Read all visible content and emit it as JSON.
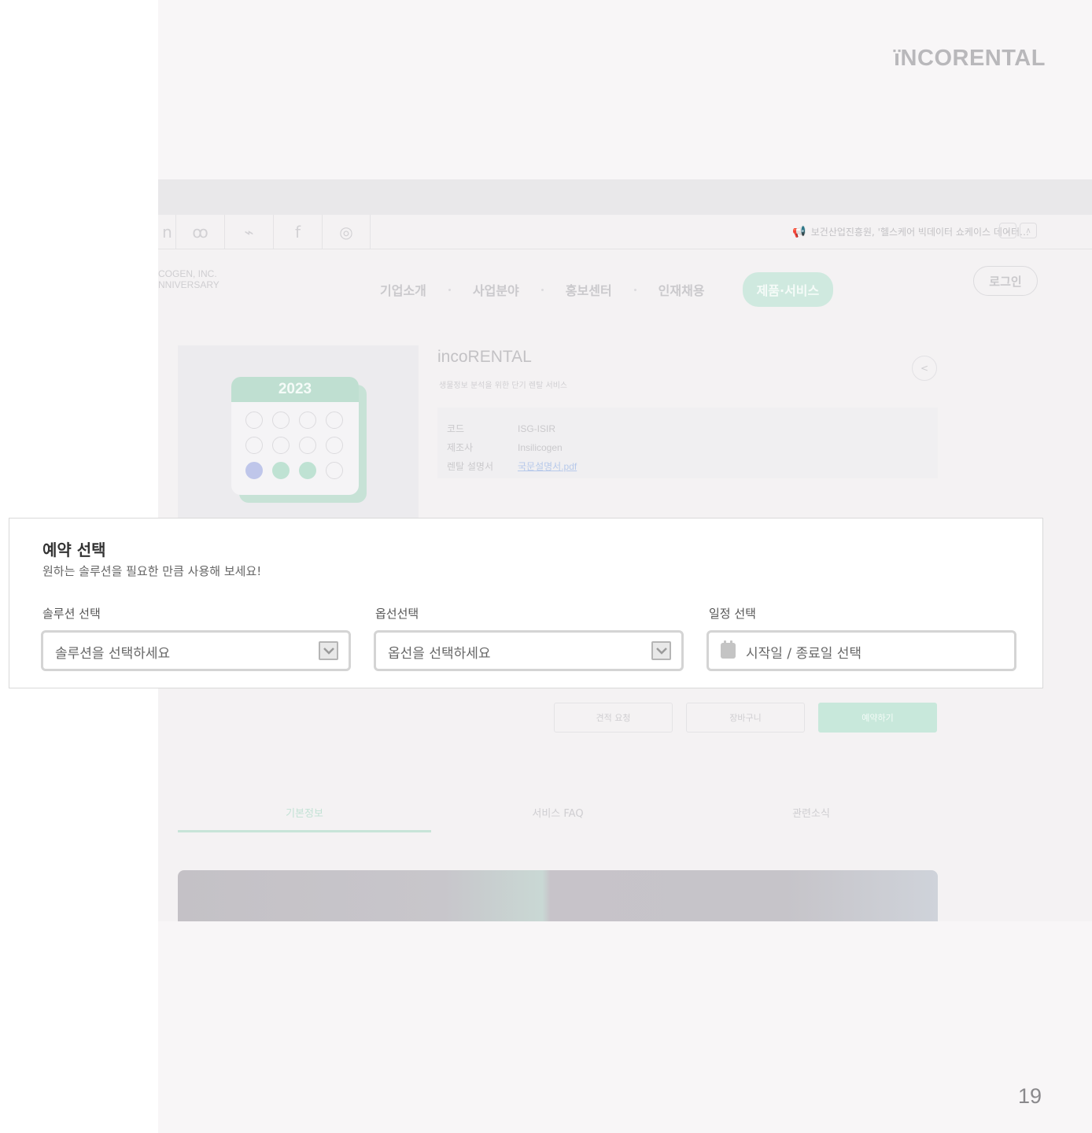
{
  "slide": {
    "logo": "ïNCORENTAL",
    "page_number": "19"
  },
  "website": {
    "notice": "보건산업진흥원, '헬스케어 빅데이터 쇼케이스 데이터…",
    "brand_line1": "COGEN, INC.",
    "brand_line2": "NNIVERSARY",
    "menu": [
      "기업소개",
      "사업분야",
      "홍보센터",
      "인재채용",
      "제품·서비스"
    ],
    "login": "로그인",
    "calendar_year": "2023",
    "product_title": "incoRENTAL",
    "product_subtitle": "생물정보 분석을 위한 단기 렌탈 서비스",
    "info": {
      "code_label": "코드",
      "code_value": "ISG-ISIR",
      "maker_label": "제조사",
      "maker_value": "Insilicogen",
      "manual_label": "렌탈 설명서",
      "manual_value": "국문설명서.pdf"
    },
    "buttons": {
      "quote": "견적 요청",
      "cart": "장바구니",
      "reserve": "예약하기"
    },
    "tabs": [
      "기본정보",
      "서비스 FAQ",
      "관련소식"
    ]
  },
  "reservation": {
    "title": "예약 선택",
    "subtitle": "원하는 솔루션을 필요한 만큼 사용해 보세요!",
    "solution": {
      "label": "솔루션 선택",
      "placeholder": "솔루션을 선택하세요"
    },
    "option": {
      "label": "옵선선택",
      "placeholder": "옵선을 선택하세요"
    },
    "schedule": {
      "label": "일정 선택",
      "placeholder": "시작일 / 종료일 선택"
    }
  }
}
